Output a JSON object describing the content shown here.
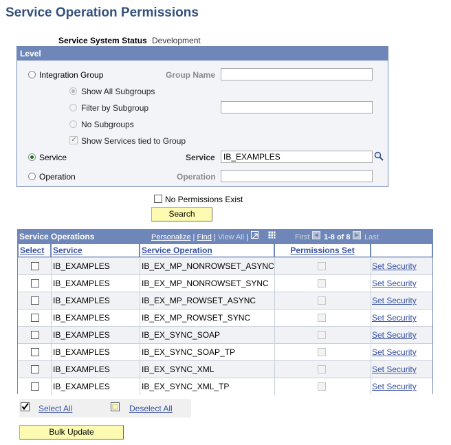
{
  "page": {
    "title": "Service Operation Permissions"
  },
  "status": {
    "label": "Service System Status",
    "value": "Development"
  },
  "level": {
    "header": "Level",
    "integration_group": {
      "label": "Integration Group",
      "checked": false
    },
    "group_name": {
      "label": "Group Name",
      "value": ""
    },
    "subgroups": {
      "show_all": {
        "label": "Show All Subgroups",
        "checked": true
      },
      "filter": {
        "label": "Filter by Subgroup",
        "checked": false,
        "value": ""
      },
      "none": {
        "label": "No Subgroups",
        "checked": false
      }
    },
    "show_services": {
      "label": "Show Services tied to Group",
      "checked": true
    },
    "service": {
      "radio_label": "Service",
      "checked": true,
      "field_label": "Service",
      "value": "IB_EXAMPLES"
    },
    "operation": {
      "radio_label": "Operation",
      "checked": false,
      "field_label": "Operation",
      "value": ""
    }
  },
  "no_permissions": {
    "label": "No Permissions Exist",
    "checked": false
  },
  "search_button": {
    "label": "Search"
  },
  "grid": {
    "title": "Service Operations",
    "nav": {
      "personalize": "Personalize",
      "sep": "|",
      "find": "Find",
      "view_all": "View All",
      "first": "First",
      "range": "1-8 of 8",
      "last": "Last"
    },
    "columns": {
      "select": "Select",
      "service": "Service",
      "operation": "Service Operation",
      "permissions": "Permissions Set"
    },
    "rows": [
      {
        "service": "IB_EXAMPLES",
        "operation": "IB_EX_MP_NONROWSET_ASYNC",
        "link": "Set Security"
      },
      {
        "service": "IB_EXAMPLES",
        "operation": "IB_EX_MP_NONROWSET_SYNC",
        "link": "Set Security"
      },
      {
        "service": "IB_EXAMPLES",
        "operation": "IB_EX_MP_ROWSET_ASYNC",
        "link": "Set Security"
      },
      {
        "service": "IB_EXAMPLES",
        "operation": "IB_EX_MP_ROWSET_SYNC",
        "link": "Set Security"
      },
      {
        "service": "IB_EXAMPLES",
        "operation": "IB_EX_SYNC_SOAP",
        "link": "Set Security"
      },
      {
        "service": "IB_EXAMPLES",
        "operation": "IB_EX_SYNC_SOAP_TP",
        "link": "Set Security"
      },
      {
        "service": "IB_EXAMPLES",
        "operation": "IB_EX_SYNC_XML",
        "link": "Set Security"
      },
      {
        "service": "IB_EXAMPLES",
        "operation": "IB_EX_SYNC_XML_TP",
        "link": "Set Security"
      }
    ]
  },
  "select_all": {
    "label": "Select All"
  },
  "deselect_all": {
    "label": "Deselect All"
  },
  "bulk_update": {
    "label": "Bulk Update"
  },
  "icons": {
    "lookup": "magnifier-icon",
    "zoom": "zoom-icon",
    "download": "download-grid-icon",
    "prev": "prev-arrow-icon",
    "next": "next-arrow-icon"
  },
  "colors": {
    "title": "#33507d",
    "header": "#6f87b8",
    "button": "#fdfbb1",
    "link": "#3751a0"
  }
}
